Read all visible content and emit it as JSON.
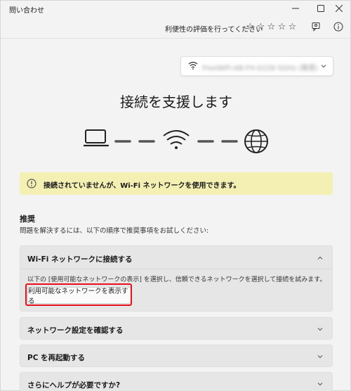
{
  "window": {
    "title": "問い合わせ",
    "controls": {
      "minimize": "—",
      "maximize": "☐",
      "close": "✕"
    }
  },
  "rating": {
    "label": "利便性の評価を行ってください",
    "stars": [
      "☆",
      "☆",
      "☆",
      "☆",
      "☆"
    ]
  },
  "network": {
    "ssid": "FreeWiFi-AB-PX-0228-5GHz (推奨)"
  },
  "main": {
    "heading": "接続を支援します",
    "warning": "接続されていませんが、Wi-Fi ネットワークを使用できます。"
  },
  "recommendations": {
    "title": "推奨",
    "description": "問題を解決するには、以下の順序で推奨事項をお試しください:",
    "items": [
      {
        "title": "Wi-Fi ネットワークに接続する",
        "body": "以下の [使用可能なネットワークの表示] を選択し、信頼できるネットワークを選択して接続を試みます。",
        "button": "利用可能なネットワークを表示する"
      },
      {
        "title": "ネットワーク設定を確認する"
      },
      {
        "title": "PC を再起動する"
      },
      {
        "title": "さらにヘルプが必要ですか?"
      }
    ]
  },
  "colors": {
    "warning_bg": "#f4f0b4",
    "highlight": "#e8101a",
    "panel_bg": "#e6e6e6"
  }
}
